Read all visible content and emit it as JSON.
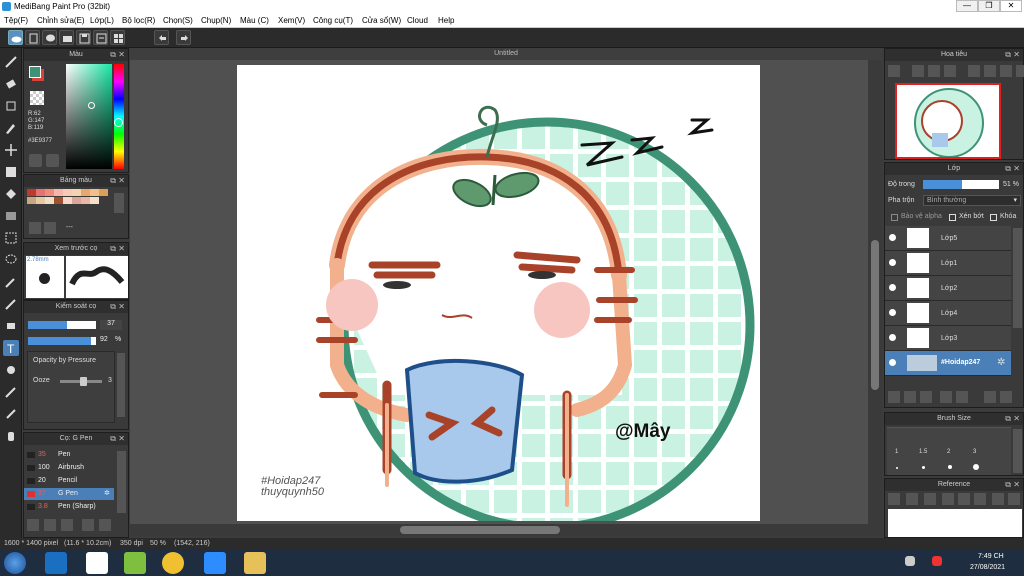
{
  "window": {
    "title": "MediBang Paint Pro (32bit)",
    "minimize": "—",
    "maximize": "❒",
    "close": "✕"
  },
  "menu": [
    "Tệp(F)",
    "Chỉnh sửa(E)",
    "Lớp(L)",
    "Bộ lọc(R)",
    "Chọn(S)",
    "Chụp(N)",
    "Màu (C)",
    "Xem(V)",
    "Công cụ(T)",
    "Cửa sổ(W)",
    "Cloud",
    "Help"
  ],
  "document": {
    "tab_title": "Untitled"
  },
  "color_panel": {
    "title": "Màu",
    "r": "R:62",
    "g": "G:147",
    "b": "B:119",
    "hex": "#3E9377",
    "fg_color": "#3e9377",
    "bg_color": "#d9433a"
  },
  "palette_panel": {
    "title": "Bảng màu",
    "dash": "---"
  },
  "brush_preview": {
    "title": "Xem trước cọ",
    "size": "2.78mm"
  },
  "brush_control": {
    "title": "Kiểm soát cọ",
    "size_value": "37",
    "opacity_value": "92",
    "opacity_unit": "%",
    "opacity_pressure": "Opacity by Pressure",
    "ooze_label": "Ooze",
    "ooze_value": "3"
  },
  "brush_list": {
    "title": "Cọ: G Pen",
    "items": [
      {
        "size": "35",
        "name": "Pen",
        "color": "#222"
      },
      {
        "size": "100",
        "name": "Airbrush",
        "color": "#222"
      },
      {
        "size": "20",
        "name": "Pencil",
        "color": "#222"
      },
      {
        "size": "37",
        "name": "G Pen",
        "color": "#e03030"
      },
      {
        "size": "3.8",
        "name": "Pen (Sharp)",
        "color": "#222"
      }
    ],
    "selected": 3
  },
  "navigator": {
    "title": "Hoa tiêu"
  },
  "layers": {
    "title": "Lớp",
    "opacity_label": "Độ trong",
    "opacity_value": "51 %",
    "blend_label": "Pha trộn",
    "blend_value": "Bình thường",
    "protect_alpha": "Bảo vệ alpha",
    "clipping": "Xén bớt",
    "lock": "Khóa",
    "items": [
      "Lớp5",
      "Lớp1",
      "Lớp2",
      "Lớp4",
      "Lớp3",
      "#Hoidap247"
    ],
    "selected": 5
  },
  "brush_size": {
    "title": "Brush Size",
    "labels": [
      "1",
      "1.5",
      "2",
      "3"
    ]
  },
  "reference": {
    "title": "Reference"
  },
  "canvas_text": {
    "watermark1": "#Hoidap247",
    "watermark2": "thuyquynh50",
    "signature": "@Mây",
    "zzz": "z z z"
  },
  "status": {
    "size": "1600 * 1400 pixel",
    "cm": "(11.6 * 10.2cm)",
    "dpi": "350 dpi",
    "zoom": "50 %",
    "coords": "(1542, 216)"
  },
  "taskbar": {
    "time": "7:49 CH",
    "date": "27/08/2021"
  },
  "colors": {
    "accent": "#4a7fb8",
    "mint": "#c9f2e3",
    "teal_ring": "#3e9377",
    "brown": "#a8432a",
    "peach": "#f2b18c",
    "blush": "#f7c6c0",
    "blue": "#a8c8ec"
  }
}
